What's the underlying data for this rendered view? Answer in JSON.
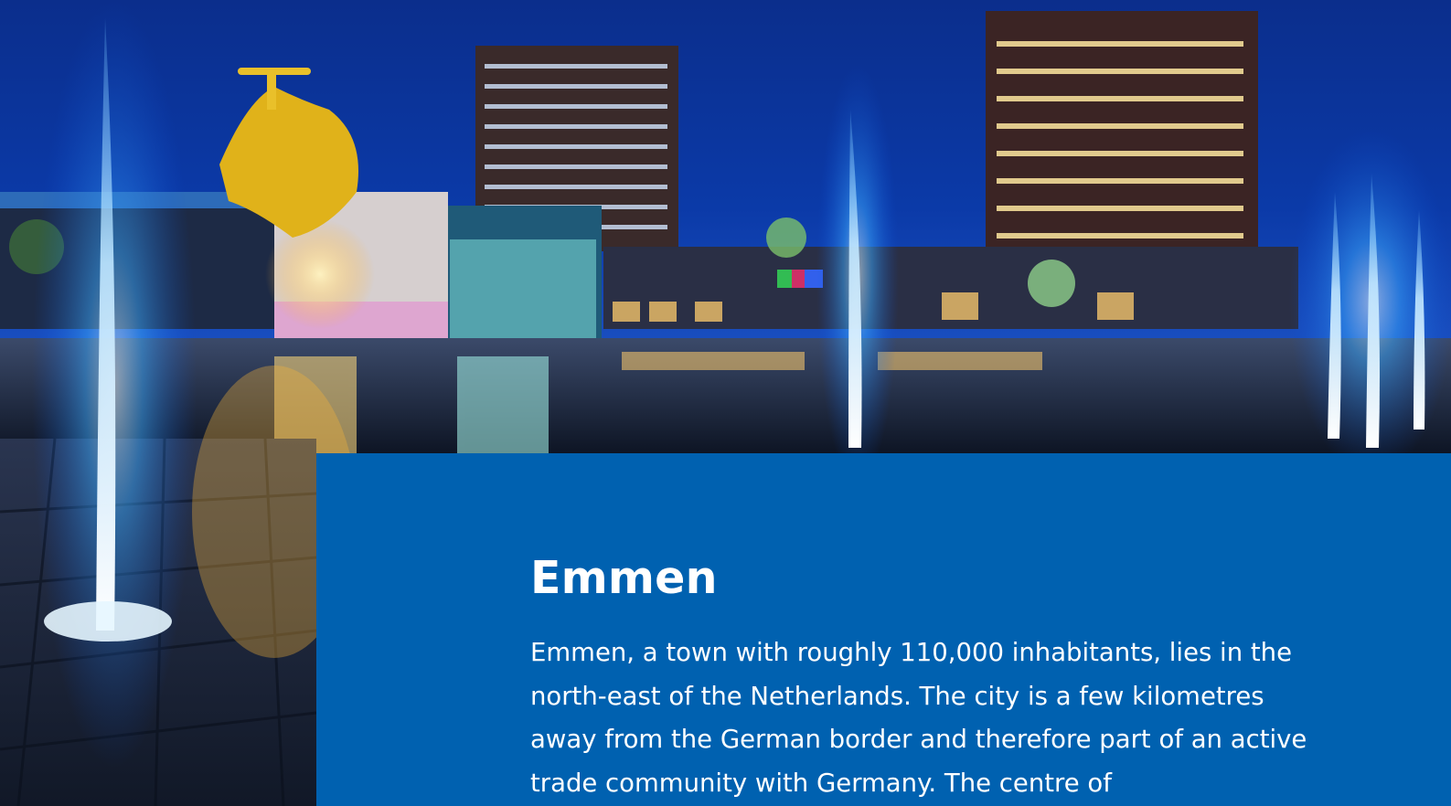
{
  "hero": {
    "image_icon": "photo-night-fountains-city-square"
  },
  "article": {
    "title": "Emmen",
    "body": "Emmen, a town with roughly 110,000 inhabitants, lies in the north-east of the Netherlands. The city is a few kilometres away from the German border and therefore part of an active trade community with Germany. The centre of"
  },
  "colors": {
    "card_background": "#0061b0",
    "text": "#ffffff",
    "sky": "#0a2a78"
  }
}
